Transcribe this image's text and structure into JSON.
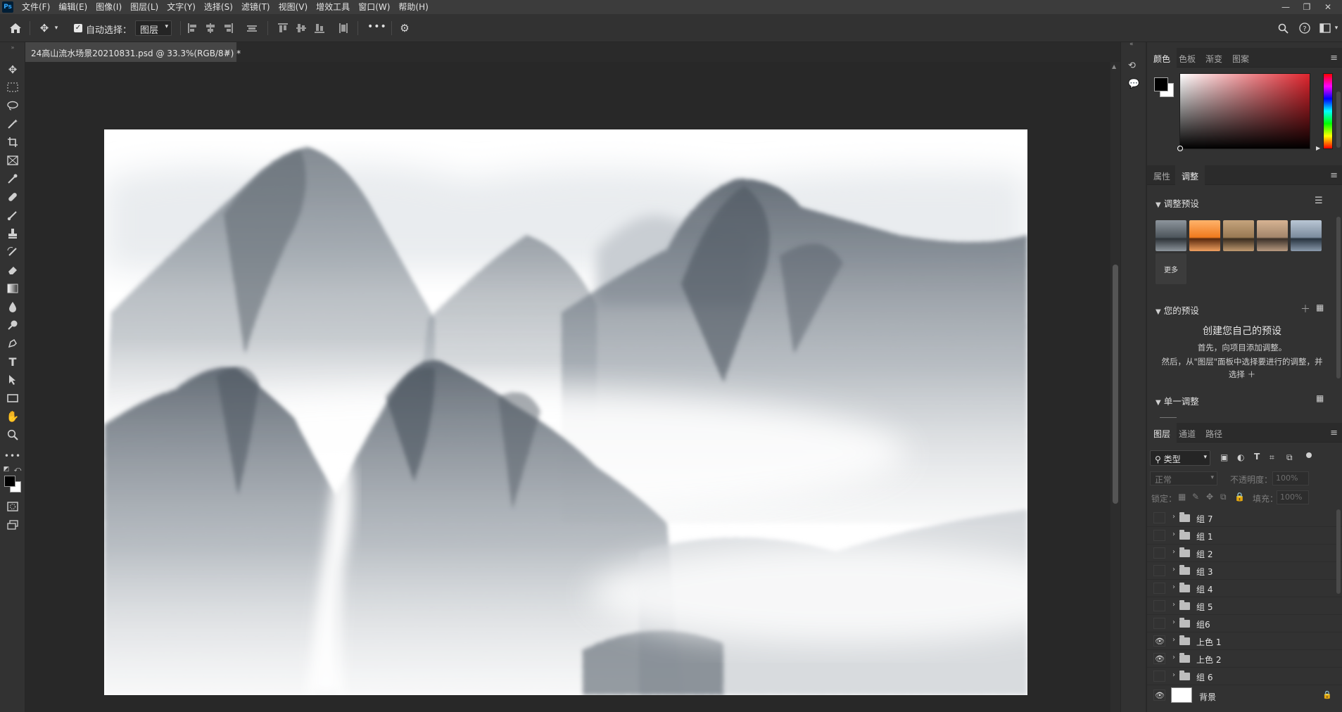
{
  "app": {
    "logo": "Ps",
    "menu": [
      "文件(F)",
      "编辑(E)",
      "图像(I)",
      "图层(L)",
      "文字(Y)",
      "选择(S)",
      "滤镜(T)",
      "视图(V)",
      "增效工具",
      "窗口(W)",
      "帮助(H)"
    ]
  },
  "options_bar": {
    "auto_select_label": "自动选择：",
    "auto_select_checked": true,
    "auto_select_target": "图层",
    "more_label": "•••"
  },
  "document_tab": {
    "title": "24高山流水场景20210831.psd @ 33.3%(RGB/8#) *",
    "close": "×"
  },
  "color_panel": {
    "tabs": [
      "颜色",
      "色板",
      "渐变",
      "图案"
    ],
    "active_tab": "颜色",
    "foreground": "#000000",
    "background": "#ffffff",
    "hue_color": "#e0242d"
  },
  "adjust_panel": {
    "tabs": [
      "属性",
      "调整"
    ],
    "active_tab": "调整",
    "presets_header": "调整预设",
    "more_label": "更多",
    "your_presets_header": "您的预设",
    "create_title": "创建您自己的预设",
    "create_line1": "首先，向项目添加调整。",
    "create_line2": "然后，从\"图层\"面板中选择要进行的调整，并",
    "create_line3": "选择 ＋",
    "single_adjust_header": "单一调整"
  },
  "layers_panel": {
    "tabs": [
      "图层",
      "通道",
      "路径"
    ],
    "active_tab": "图层",
    "filter_label": "类型",
    "blend_mode": "正常",
    "opacity_label": "不透明度：",
    "opacity_value": "100%",
    "lock_label": "锁定：",
    "fill_label": "填充：",
    "fill_value": "100%",
    "layers": [
      {
        "name": "组 7",
        "visible": false,
        "type": "group"
      },
      {
        "name": "组 1",
        "visible": false,
        "type": "group"
      },
      {
        "name": "组 2",
        "visible": false,
        "type": "group"
      },
      {
        "name": "组 3",
        "visible": false,
        "type": "group"
      },
      {
        "name": "组 4",
        "visible": false,
        "type": "group"
      },
      {
        "name": "组 5",
        "visible": false,
        "type": "group"
      },
      {
        "name": "组6",
        "visible": false,
        "type": "group"
      },
      {
        "name": "上色 1",
        "visible": true,
        "type": "group"
      },
      {
        "name": "上色 2",
        "visible": true,
        "type": "group"
      },
      {
        "name": "组 6",
        "visible": false,
        "type": "group"
      }
    ],
    "background_layer": {
      "name": "背景",
      "visible": true,
      "locked": true
    }
  }
}
